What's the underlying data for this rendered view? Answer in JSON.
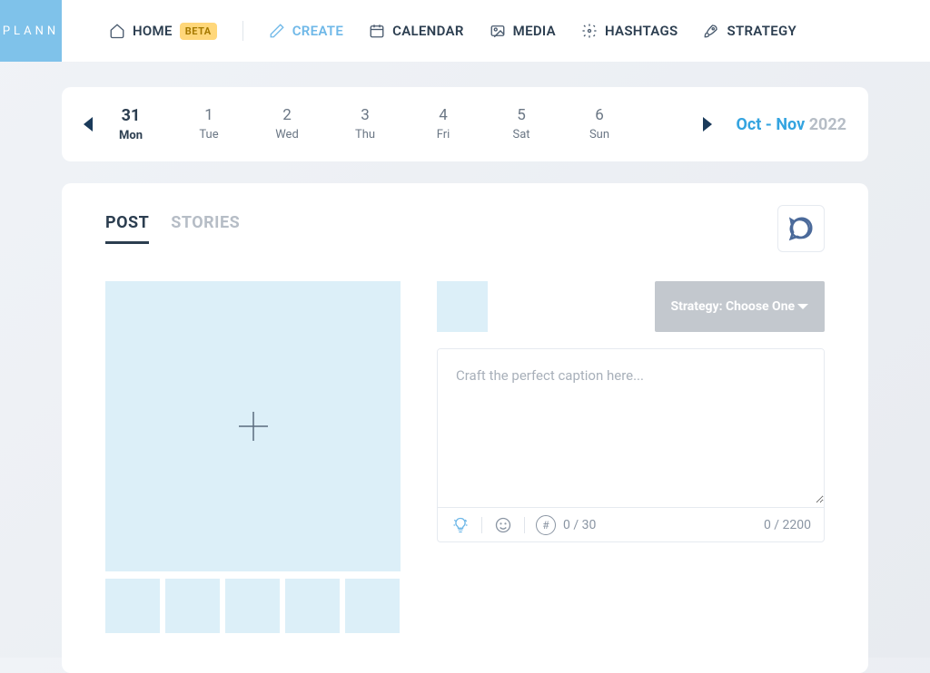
{
  "logo": "PLANN",
  "nav": {
    "home": "HOME",
    "home_badge": "BETA",
    "create": "CREATE",
    "calendar": "CALENDAR",
    "media": "MEDIA",
    "hashtags": "HASHTAGS",
    "strategy": "STRATEGY"
  },
  "week": {
    "range": "Oct - Nov",
    "year": "2022",
    "days": [
      {
        "num": "31",
        "name": "Mon",
        "today": true
      },
      {
        "num": "1",
        "name": "Tue"
      },
      {
        "num": "2",
        "name": "Wed"
      },
      {
        "num": "3",
        "name": "Thu"
      },
      {
        "num": "4",
        "name": "Fri"
      },
      {
        "num": "5",
        "name": "Sat"
      },
      {
        "num": "6",
        "name": "Sun"
      }
    ]
  },
  "tabs": {
    "post": "POST",
    "stories": "STORIES"
  },
  "strategy_select": "Strategy: Choose One",
  "caption": {
    "placeholder": "Craft the perfect caption here..."
  },
  "counters": {
    "hashtags": "0 / 30",
    "chars": "0 / 2200"
  }
}
